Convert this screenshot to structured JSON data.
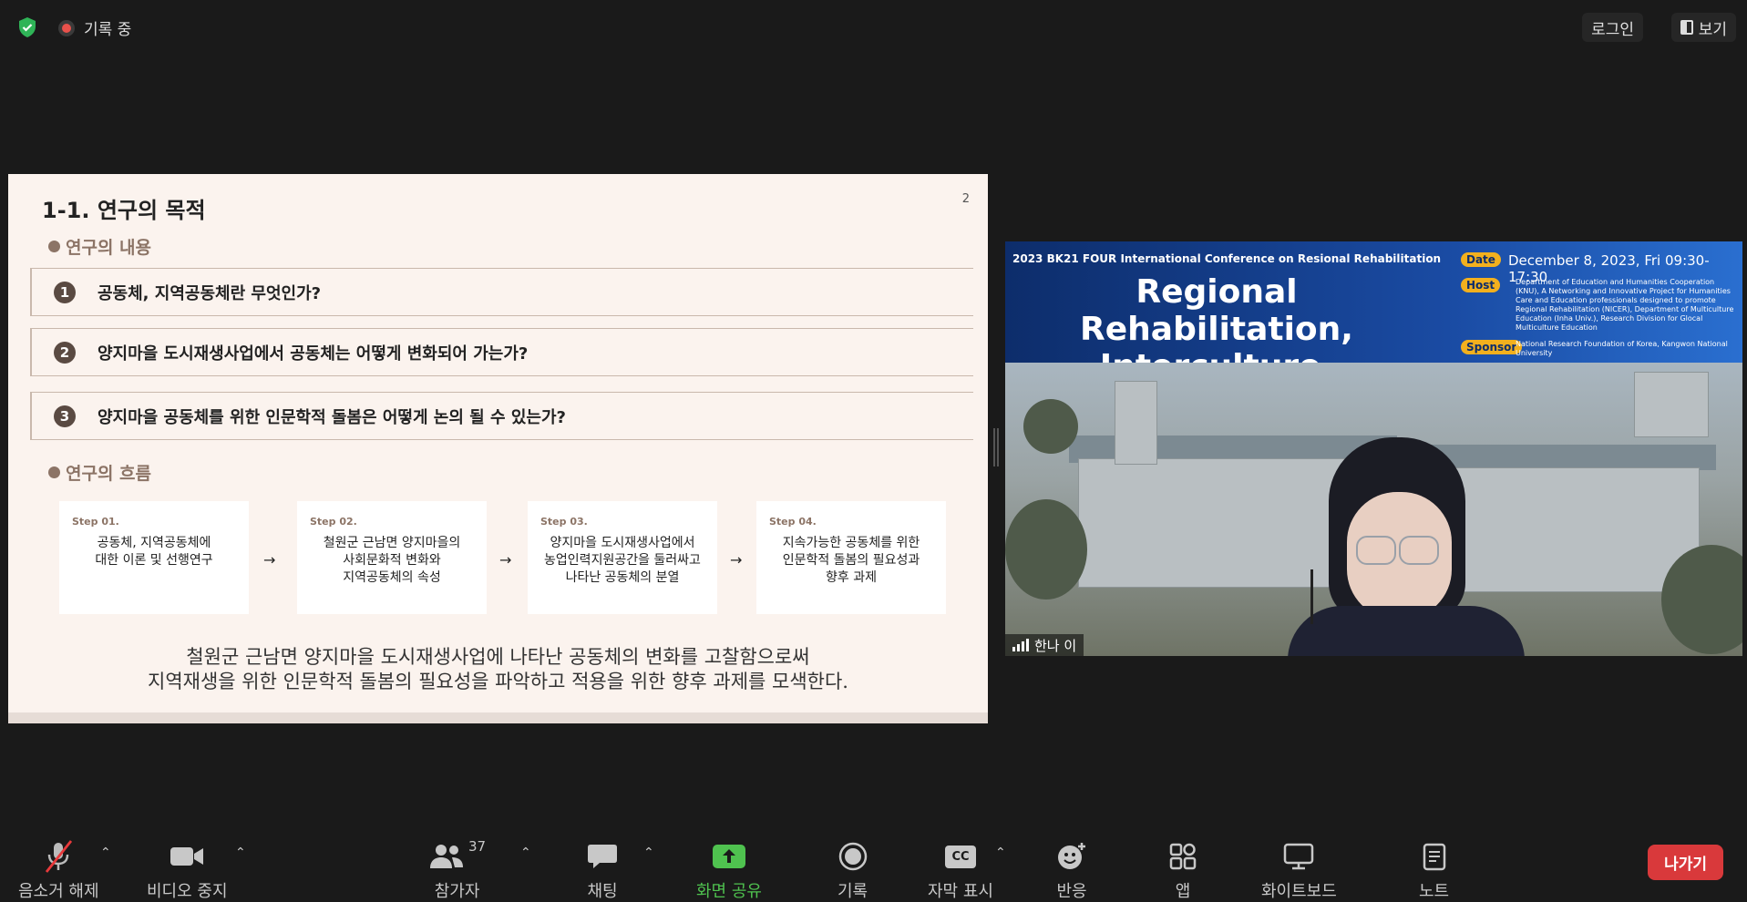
{
  "topbar": {
    "recording_label": "기록 중",
    "login_label": "로그인",
    "view_label": "보기"
  },
  "slide": {
    "title": "1-1. 연구의 목적",
    "page_number": "2",
    "section1": "연구의 내용",
    "questions": [
      {
        "num": "1",
        "text": "공동체, 지역공동체란 무엇인가?"
      },
      {
        "num": "2",
        "text": "양지마을 도시재생사업에서 공동체는 어떻게 변화되어 가는가?"
      },
      {
        "num": "3",
        "text": "양지마을 공동체를 위한 인문학적 돌봄은 어떻게 논의 될 수 있는가?"
      }
    ],
    "section2": "연구의 흐름",
    "steps": [
      {
        "label": "Step 01.",
        "text": "공동체, 지역공동체에\n대한 이론 및 선행연구"
      },
      {
        "label": "Step 02.",
        "text": "철원군 근남면 양지마을의\n사회문화적 변화와\n지역공동체의 속성"
      },
      {
        "label": "Step 03.",
        "text": "양지마을 도시재생사업에서\n농업인력지원공간을 둘러싸고\n나타난 공동체의 분열"
      },
      {
        "label": "Step 04.",
        "text": "지속가능한 공동체를 위한\n인문학적 돌봄의 필요성과\n향후 과제"
      }
    ],
    "arrow": "→",
    "summary_line1": "철원군 근남면 양지마을 도시재생사업에 나타난 공동체의 변화를 고찰함으로써",
    "summary_line2": "지역재생을 위한 인문학적 돌봄의 필요성을 파악하고 적용을 위한 향후 과제를 모색한다."
  },
  "video": {
    "conference": "2023 BK21 FOUR International Conference on Resional Rehabilitation",
    "title_line1": "Regional Rehabilitation,",
    "title_line2": "Interculture, Healing",
    "date_tag": "Date",
    "date": "December 8, 2023, Fri 09:30-17:30",
    "host_tag": "Host",
    "host": "Department of Education and Humanities Cooperation (KNU), A Networking and Innovative Project for Humanities Care and Education professionals designed to promote Regional Rehabilitation (NICER), Department of Multiculture Education (Inha Univ.), Research Division for Glocal Multiculture Education",
    "sponsor_tag": "Sponsor",
    "sponsor": "National Research Foundation of Korea, Kangwon National University",
    "participant_name": "한나 이"
  },
  "toolbar": {
    "mute": "음소거 해제",
    "video": "비디오 중지",
    "participants": "참가자",
    "participant_count": "37",
    "chat": "채팅",
    "share": "화면 공유",
    "record": "기록",
    "captions": "자막 표시",
    "cc_icon_text": "CC",
    "reactions": "반응",
    "apps": "앱",
    "whiteboard": "화이트보드",
    "notes": "노트",
    "leave": "나가기"
  },
  "colors": {
    "background": "#1a1a1a",
    "share_green": "#4fc24f",
    "leave_red": "#d9393b",
    "slide_bg": "#fbf3ee",
    "slide_accent": "#8c7466"
  }
}
